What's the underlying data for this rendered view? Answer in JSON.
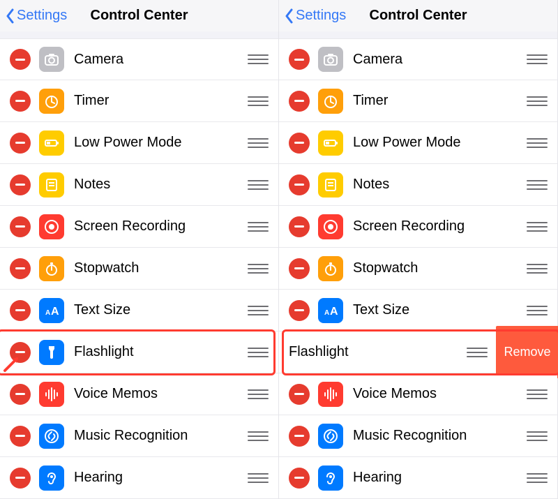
{
  "nav": {
    "back_label": "Settings",
    "title": "Control Center"
  },
  "remove_button_label": "Remove",
  "left_panel": {
    "highlighted_index": 7,
    "items": [
      {
        "name": "camera",
        "label": "Camera",
        "icon": "camera-icon",
        "bg": "bg-grey"
      },
      {
        "name": "timer",
        "label": "Timer",
        "icon": "timer-icon",
        "bg": "bg-orange"
      },
      {
        "name": "low-power-mode",
        "label": "Low Power Mode",
        "icon": "battery-icon",
        "bg": "bg-yellow"
      },
      {
        "name": "notes",
        "label": "Notes",
        "icon": "notes-icon",
        "bg": "bg-yellow"
      },
      {
        "name": "screen-recording",
        "label": "Screen Recording",
        "icon": "record-icon",
        "bg": "bg-red"
      },
      {
        "name": "stopwatch",
        "label": "Stopwatch",
        "icon": "stopwatch-icon",
        "bg": "bg-orange"
      },
      {
        "name": "text-size",
        "label": "Text Size",
        "icon": "text-size-icon",
        "bg": "bg-blue"
      },
      {
        "name": "flashlight",
        "label": "Flashlight",
        "icon": "flashlight-icon",
        "bg": "bg-blue"
      },
      {
        "name": "voice-memos",
        "label": "Voice Memos",
        "icon": "waveform-icon",
        "bg": "bg-red"
      },
      {
        "name": "music-recognition",
        "label": "Music Recognition",
        "icon": "shazam-icon",
        "bg": "bg-blue"
      },
      {
        "name": "hearing",
        "label": "Hearing",
        "icon": "ear-icon",
        "bg": "bg-blue"
      }
    ]
  },
  "right_panel": {
    "swiped_index": 7,
    "highlighted_index": 7,
    "items": [
      {
        "name": "camera",
        "label": "Camera",
        "icon": "camera-icon",
        "bg": "bg-grey"
      },
      {
        "name": "timer",
        "label": "Timer",
        "icon": "timer-icon",
        "bg": "bg-orange"
      },
      {
        "name": "low-power-mode",
        "label": "Low Power Mode",
        "icon": "battery-icon",
        "bg": "bg-yellow"
      },
      {
        "name": "notes",
        "label": "Notes",
        "icon": "notes-icon",
        "bg": "bg-yellow"
      },
      {
        "name": "screen-recording",
        "label": "Screen Recording",
        "icon": "record-icon",
        "bg": "bg-red"
      },
      {
        "name": "stopwatch",
        "label": "Stopwatch",
        "icon": "stopwatch-icon",
        "bg": "bg-orange"
      },
      {
        "name": "text-size",
        "label": "Text Size",
        "icon": "text-size-icon",
        "bg": "bg-blue"
      },
      {
        "name": "flashlight",
        "label": "Flashlight",
        "icon": "flashlight-icon",
        "bg": "bg-blue"
      },
      {
        "name": "voice-memos",
        "label": "Voice Memos",
        "icon": "waveform-icon",
        "bg": "bg-red"
      },
      {
        "name": "music-recognition",
        "label": "Music Recognition",
        "icon": "shazam-icon",
        "bg": "bg-blue"
      },
      {
        "name": "hearing",
        "label": "Hearing",
        "icon": "ear-icon",
        "bg": "bg-blue"
      }
    ]
  }
}
